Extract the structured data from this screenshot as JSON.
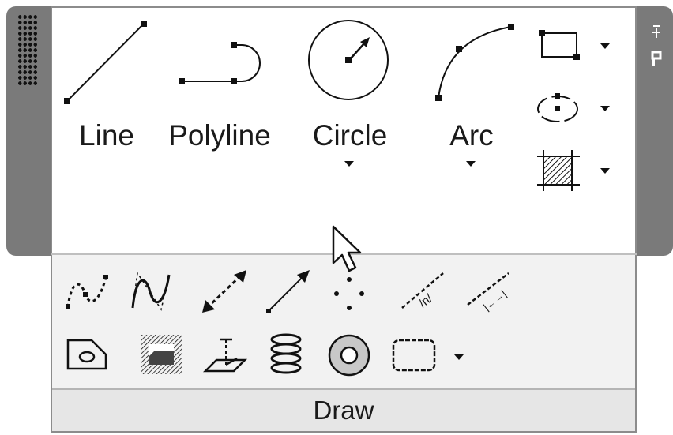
{
  "panel": {
    "title": "Draw"
  },
  "large_tools": [
    {
      "id": "line",
      "label": "Line",
      "icon": "line-icon",
      "has_dropdown": false
    },
    {
      "id": "polyline",
      "label": "Polyline",
      "icon": "polyline-icon",
      "has_dropdown": false
    },
    {
      "id": "circle",
      "label": "Circle",
      "icon": "circle-icon",
      "has_dropdown": true
    },
    {
      "id": "arc",
      "label": "Arc",
      "icon": "arc-icon",
      "has_dropdown": true
    }
  ],
  "small_tools_right": [
    {
      "id": "rectangle",
      "icon": "rectangle-icon",
      "has_dropdown": true
    },
    {
      "id": "ellipse",
      "icon": "ellipse-icon",
      "has_dropdown": true
    },
    {
      "id": "hatch",
      "icon": "hatch-icon",
      "has_dropdown": true
    }
  ],
  "expanded_row_1": [
    {
      "id": "spline-fit",
      "icon": "spline-fit-icon"
    },
    {
      "id": "spline-cv",
      "icon": "spline-control-vertices-icon"
    },
    {
      "id": "construction-line",
      "icon": "construction-line-icon"
    },
    {
      "id": "ray",
      "icon": "ray-icon"
    },
    {
      "id": "multiple-points",
      "icon": "multiple-points-icon"
    },
    {
      "id": "divide",
      "icon": "divide-icon"
    },
    {
      "id": "measure",
      "icon": "measure-icon"
    }
  ],
  "expanded_row_2": [
    {
      "id": "region",
      "icon": "region-icon"
    },
    {
      "id": "wipeout",
      "icon": "wipeout-icon"
    },
    {
      "id": "3d-polyline",
      "icon": "3d-polyline-icon"
    },
    {
      "id": "helix",
      "icon": "helix-icon"
    },
    {
      "id": "donut",
      "icon": "donut-icon"
    },
    {
      "id": "revision-cloud",
      "icon": "revision-cloud-icon",
      "has_dropdown": true
    }
  ],
  "colors": {
    "frame": "#7a7a7a",
    "panel_bg": "#ffffff",
    "slideout_bg": "#f2f2f2",
    "title_bg": "#e6e6e6"
  }
}
